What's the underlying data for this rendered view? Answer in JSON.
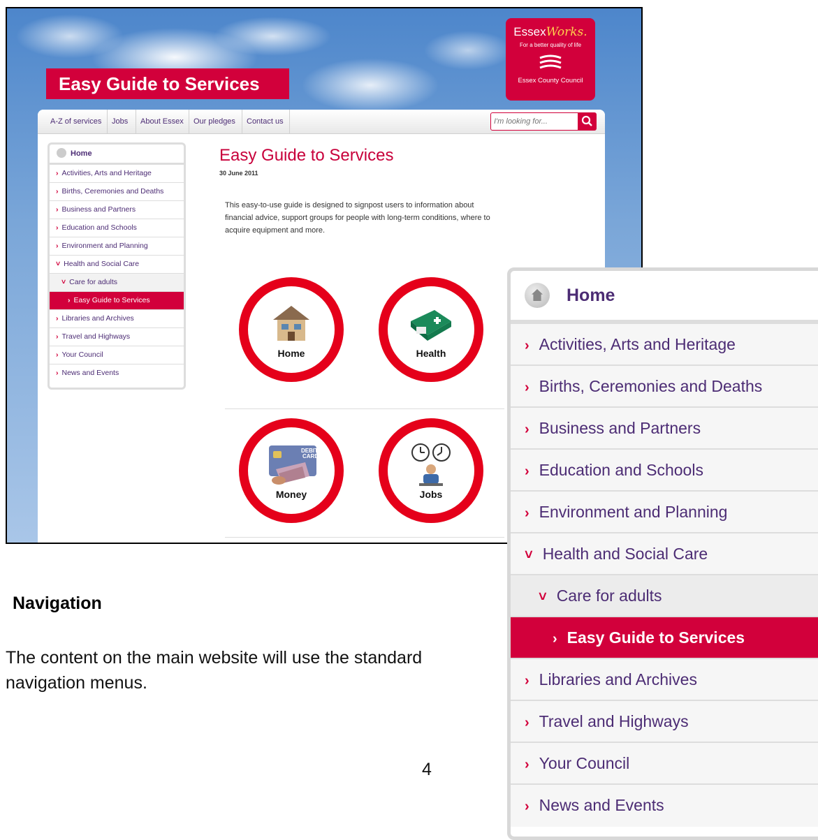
{
  "site": {
    "title": "Easy Guide to Services",
    "logo": {
      "brand_first": "Essex",
      "brand_second": "Works.",
      "tagline": "For a better quality of life",
      "council": "Essex County Council"
    },
    "top_nav": [
      "A-Z of services",
      "Jobs",
      "About Essex",
      "Our pledges",
      "Contact us"
    ],
    "search": {
      "placeholder": "I'm looking for..."
    }
  },
  "side_nav": {
    "home": "Home",
    "items": [
      "Activities, Arts and Heritage",
      "Births, Ceremonies and Deaths",
      "Business and Partners",
      "Education and Schools",
      "Environment and Planning",
      "Health and Social Care",
      "Care for adults",
      "Easy Guide to Services",
      "Libraries and Archives",
      "Travel and Highways",
      "Your Council",
      "News and Events"
    ]
  },
  "content": {
    "heading": "Easy Guide to Services",
    "date": "30 June 2011",
    "intro": "This easy-to-use guide is designed to signpost users to information about financial advice, support groups for people with long-term conditions, where to acquire equipment and more.",
    "tiles": [
      "Home",
      "Health",
      "Money",
      "Jobs"
    ],
    "debit_card": "DEBIT CARD"
  },
  "doc": {
    "heading": "Navigation",
    "paragraph": "The content on the main website will use the standard navigation menus.",
    "page_number": "4"
  },
  "colors": {
    "brand_red": "#d2003b",
    "nav_purple": "#4c2c74",
    "circle_red": "#e5001a"
  },
  "icons": [
    "home-icon",
    "search-icon",
    "chevron-right-icon",
    "chevron-down-icon",
    "house-icon",
    "first-aid-kit-icon",
    "money-card-icon",
    "clock-worker-icon"
  ]
}
